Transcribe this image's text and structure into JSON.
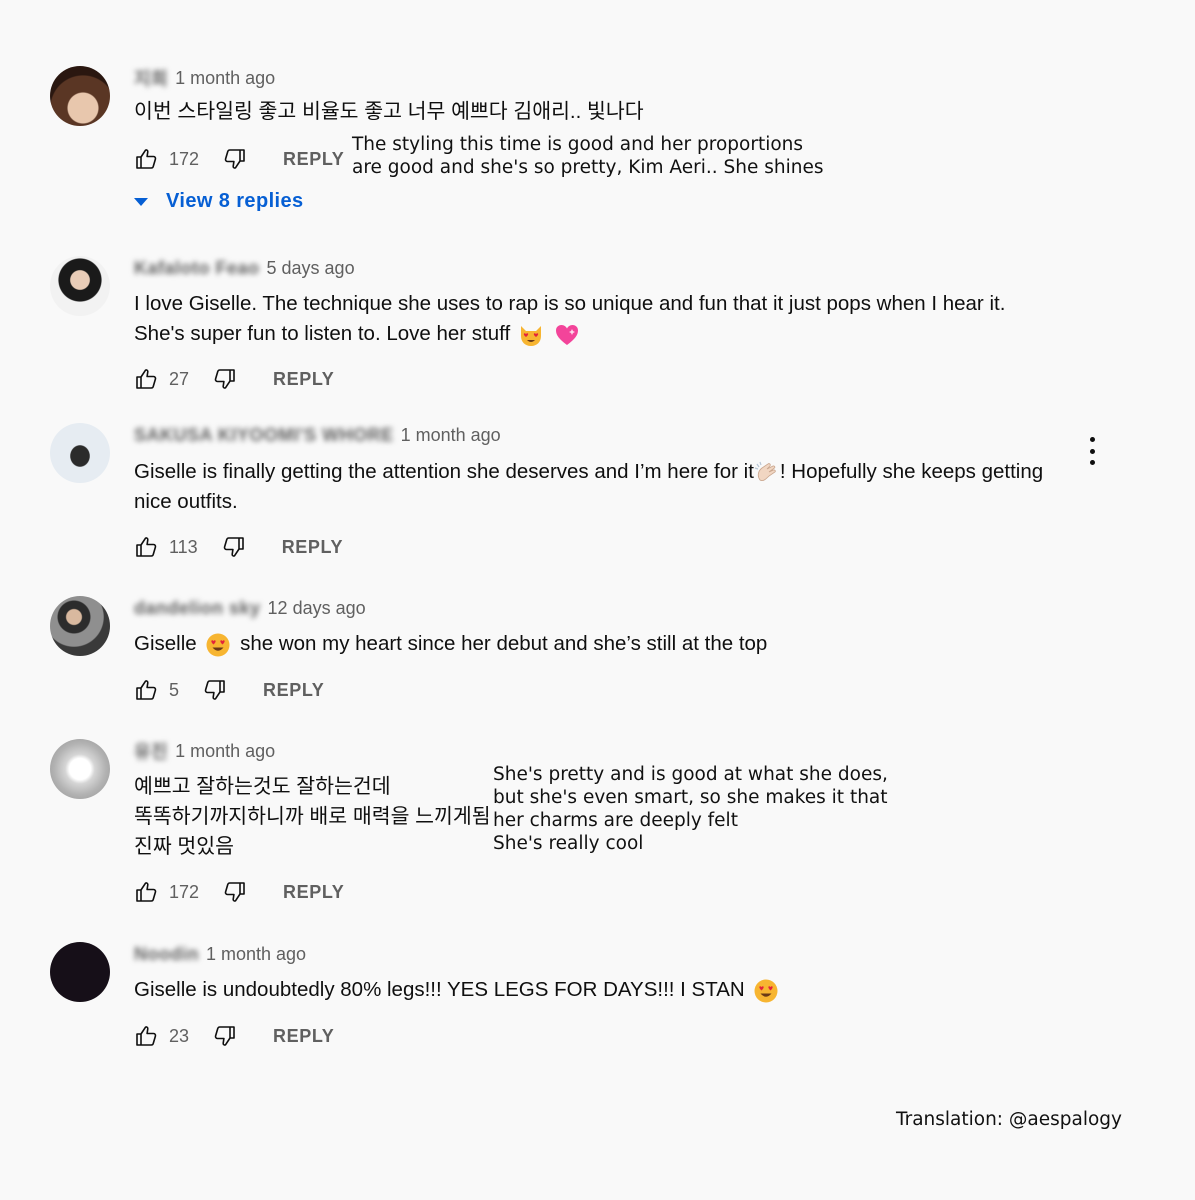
{
  "comments": [
    {
      "author": "지희",
      "time": "1 month ago",
      "lines": [
        "이번 스타일링 좋고 비율도 좋고 너무 예쁘다 김애리.. 빛나다"
      ],
      "likes": "172",
      "reply_label": "REPLY",
      "translation": [
        "The styling this time is good and her proportions",
        "are good and she's so pretty, Kim Aeri.. She shines"
      ],
      "view_replies": "View 8 replies"
    },
    {
      "author": "Kafaloto Feao",
      "time": "5 days ago",
      "lines": [
        "I love Giselle. The technique she uses to rap is so unique and fun that it just pops when I hear it.",
        "She's super fun to listen to. Love her stuff"
      ],
      "likes": "27",
      "reply_label": "REPLY"
    },
    {
      "author": "SAKUSA KIYOOMI'S WHORE",
      "time": "1 month ago",
      "lines": [
        "Giselle is finally getting the attention she deserves and I’m here for it",
        "! Hopefully she keeps getting",
        "nice outfits."
      ],
      "likes": "113",
      "reply_label": "REPLY"
    },
    {
      "author": "dandelion sky",
      "time": "12 days ago",
      "lines": [
        "Giselle",
        "she won my heart since her debut and she’s still at the top"
      ],
      "likes": "5",
      "reply_label": "REPLY"
    },
    {
      "author": "유진",
      "time": "1 month ago",
      "lines": [
        "예쁘고 잘하는것도 잘하는건데",
        "똑똑하기까지하니까 배로 매력을 느끼게됨",
        "진짜 멋있음"
      ],
      "likes": "172",
      "reply_label": "REPLY",
      "translation": [
        "She's pretty and is good at what she does,",
        "but she's even smart, so she makes it that",
        "her charms are deeply felt",
        "She's really cool"
      ]
    },
    {
      "author": "Noodin",
      "time": "1 month ago",
      "lines": [
        "Giselle is undoubtedly 80% legs!!! YES LEGS FOR DAYS!!! I STAN"
      ],
      "likes": "23",
      "reply_label": "REPLY"
    }
  ],
  "credit": "Translation: @aespalogy",
  "colors": {
    "link": "#065fd4",
    "meta": "#606060",
    "background": "#f9f9f9"
  }
}
